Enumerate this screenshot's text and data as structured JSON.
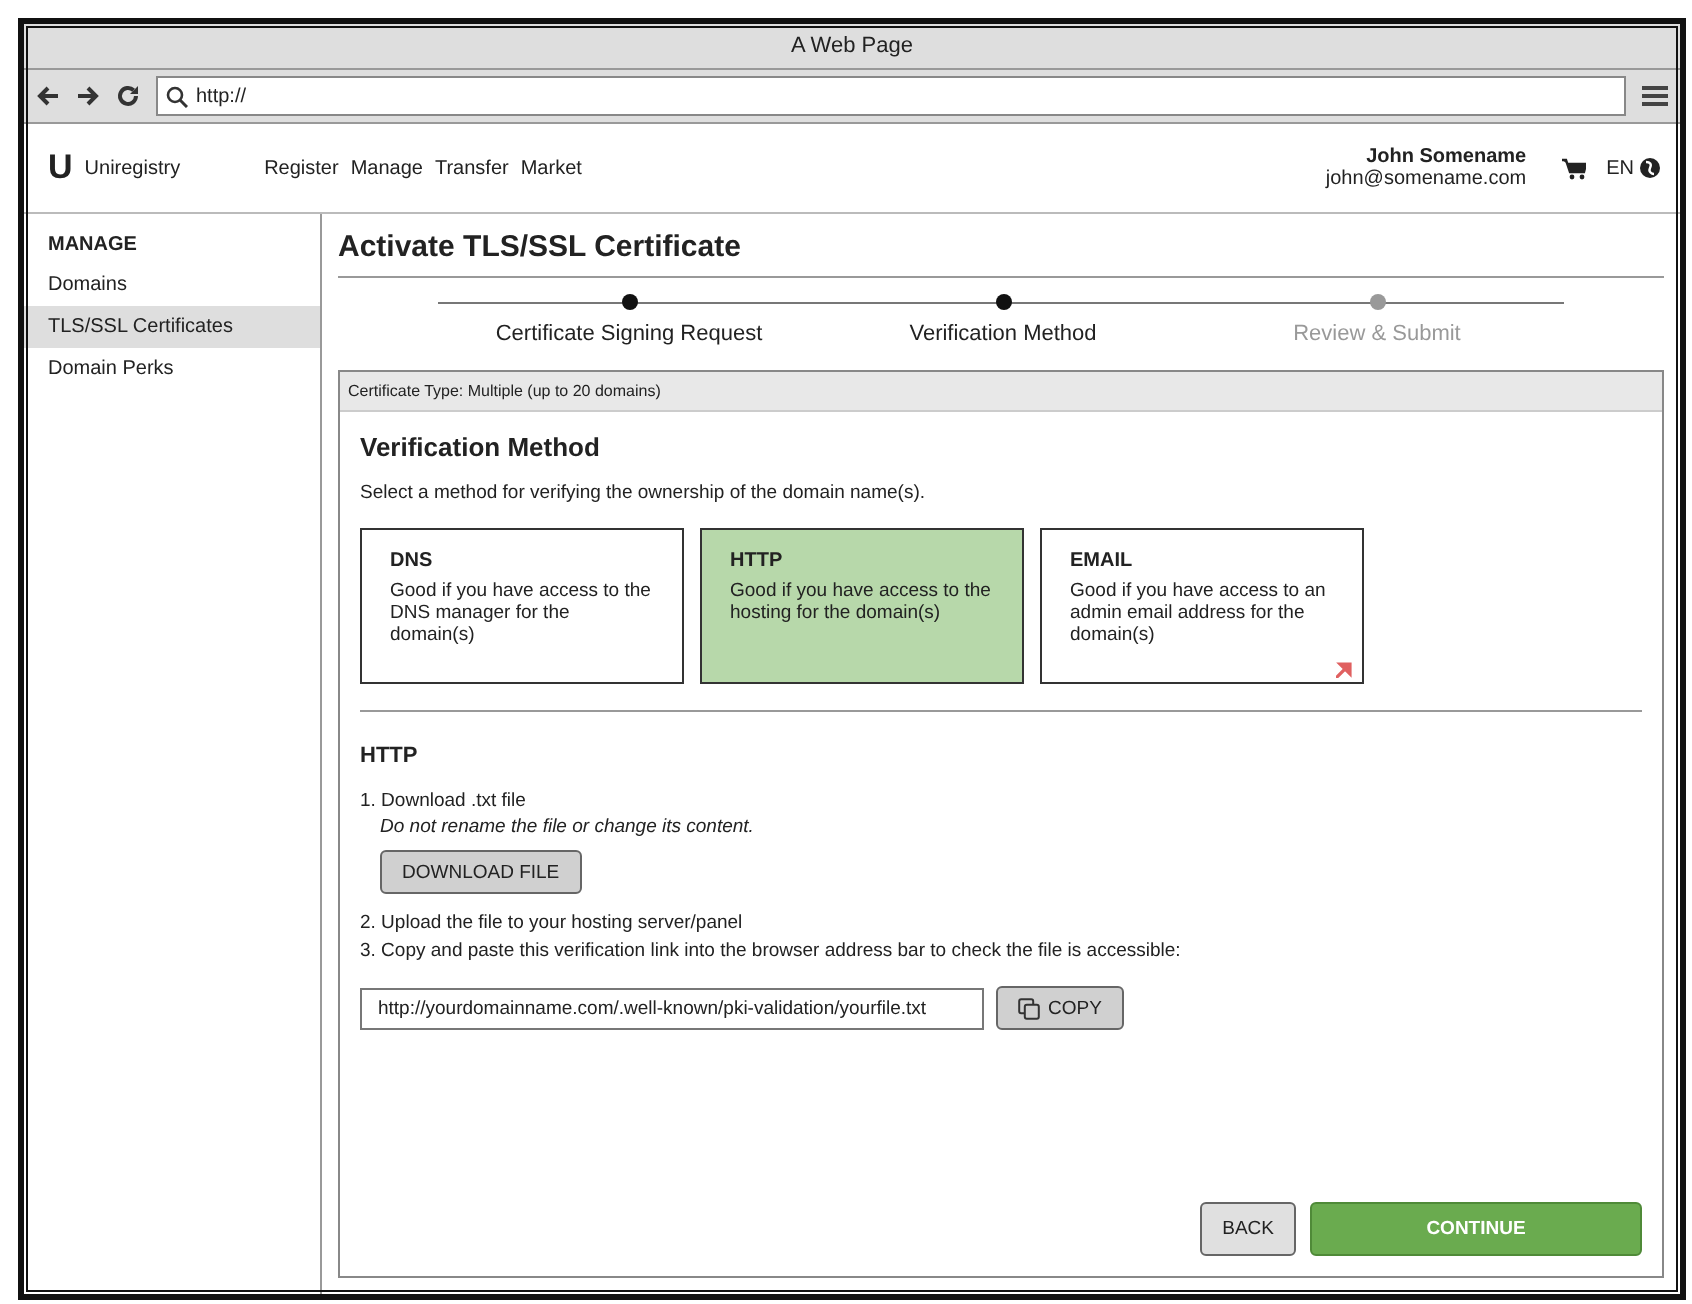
{
  "window": {
    "title": "A Web Page"
  },
  "browser": {
    "url": "http://"
  },
  "header": {
    "logo_letter": "U",
    "brand": "Uniregistry",
    "nav": [
      "Register",
      "Manage",
      "Transfer",
      "Market"
    ],
    "user_name": "John Somename",
    "user_email": "john@somename.com",
    "language": "EN"
  },
  "sidebar": {
    "heading": "MANAGE",
    "items": [
      {
        "label": "Domains",
        "selected": false
      },
      {
        "label": "TLS/SSL Certificates",
        "selected": true
      },
      {
        "label": "Domain Perks",
        "selected": false
      }
    ]
  },
  "page_title": "Activate TLS/SSL Certificate",
  "steps": [
    {
      "label": "Certificate Signing Request",
      "active": true
    },
    {
      "label": "Verification Method",
      "active": true
    },
    {
      "label": "Review & Submit",
      "active": false
    }
  ],
  "panel": {
    "header": "Certificate Type: Multiple (up to 20 domains)",
    "heading": "Verification Method",
    "description": "Select a method for verifying the ownership of the domain name(s).",
    "methods": [
      {
        "title": "DNS",
        "text": "Good if you have access to the DNS manager for the domain(s)",
        "selected": false
      },
      {
        "title": "HTTP",
        "text": "Good if you have access to the hosting for the domain(s)",
        "selected": true
      },
      {
        "title": "EMAIL",
        "text": "Good if you have access to an admin email address for the domain(s)",
        "selected": false
      }
    ],
    "section_heading": "HTTP",
    "step1": "1. Download .txt file",
    "step1_note": "Do not rename the file or change its content.",
    "download_button": "DOWNLOAD FILE",
    "step2": "2. Upload the file to your hosting server/panel",
    "step3": "3. Copy and paste this verification link into the browser address bar to check the file is accessible:",
    "link_value": "http://yourdomainname.com/.well-known/pki-validation/yourfile.txt",
    "copy_button": "COPY",
    "back_button": "BACK",
    "continue_button": "CONTINUE"
  }
}
